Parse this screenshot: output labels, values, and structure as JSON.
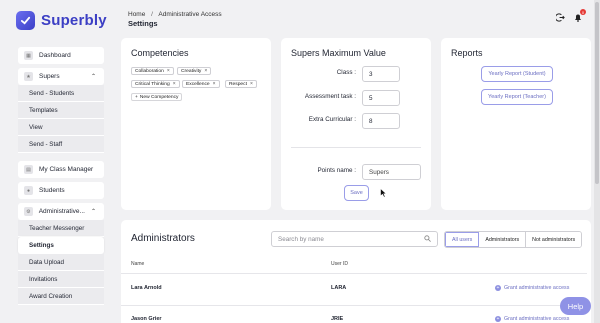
{
  "brand": {
    "name": "Superbly",
    "accent": "#3c3fc4"
  },
  "breadcrumb": {
    "home": "Home",
    "separator": "/",
    "current": "Administrative Access"
  },
  "page_title": "Settings",
  "header": {
    "notification_count": "0"
  },
  "sidebar": {
    "dashboard": "Dashboard",
    "supers": "Supers",
    "supers_items": [
      "Send - Students",
      "Templates",
      "View",
      "Send - Staff"
    ],
    "class_manager": "My Class Manager",
    "students": "Students",
    "administrative": "Administrative...",
    "admin_items": [
      "Teacher Messenger",
      "Settings",
      "Data Upload",
      "Invitations",
      "Award Creation"
    ]
  },
  "competencies": {
    "title": "Competencies",
    "chips": [
      "Collaboration",
      "Creativity",
      "Critical Thinking",
      "Excellence",
      "Respect"
    ],
    "new_button": "New Competency"
  },
  "supers_max": {
    "title": "Supers Maximum Value",
    "class_label": "Class :",
    "class_value": "3",
    "assessment_label": "Assessment task :",
    "assessment_value": "5",
    "extra_label": "Extra Curricular :",
    "extra_value": "8",
    "points_label": "Points name :",
    "points_value": "Supers",
    "save_label": "Save"
  },
  "reports": {
    "title": "Reports",
    "student_btn": "Yearly Report (Student)",
    "teacher_btn": "Yearly Report (Teacher)"
  },
  "administrators": {
    "title": "Administrators",
    "search_placeholder": "Search by name",
    "filters": [
      "All users",
      "Administrators",
      "Not administrators"
    ],
    "columns": [
      "Name",
      "User ID"
    ],
    "rows": [
      {
        "name": "Lara Arnold",
        "user_id": "LARA",
        "action": "Grant administrative access"
      },
      {
        "name": "Jason Grier",
        "user_id": "JRIE",
        "action": "Grant administrative access"
      }
    ]
  },
  "help_label": "Help"
}
